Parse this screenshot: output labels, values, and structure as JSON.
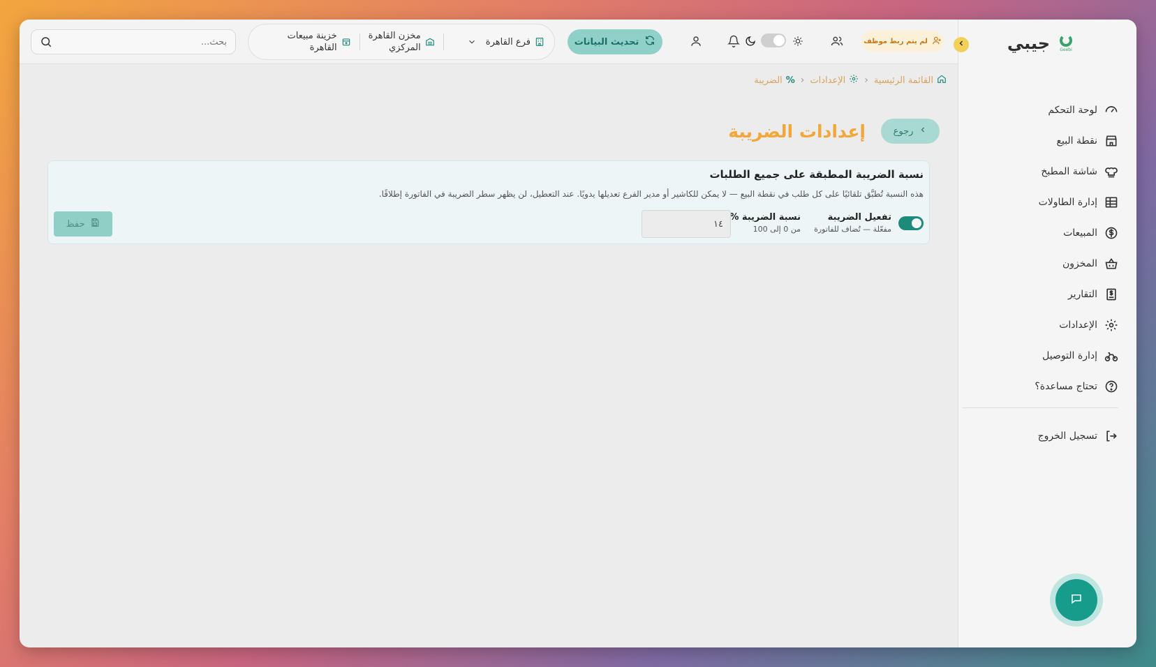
{
  "brand": {
    "name": "جيبي",
    "logo_sub": "Geebi"
  },
  "sidebar": {
    "items": [
      {
        "label": "لوحة التحكم",
        "icon": "gauge-icon"
      },
      {
        "label": "نقطة البيع",
        "icon": "store-icon"
      },
      {
        "label": "شاشة المطبخ",
        "icon": "chef-hat-icon"
      },
      {
        "label": "إدارة الطاولات",
        "icon": "table-grid-icon"
      },
      {
        "label": "المبيعات",
        "icon": "dollar-circle-icon"
      },
      {
        "label": "المخزون",
        "icon": "basket-icon"
      },
      {
        "label": "التقارير",
        "icon": "receipt-icon"
      },
      {
        "label": "الإعدادات",
        "icon": "gear-icon"
      },
      {
        "label": "إدارة التوصيل",
        "icon": "bicycle-icon"
      },
      {
        "label": "تحتاج مساعدة؟",
        "icon": "help-icon"
      }
    ],
    "logout_label": "تسجيل الخروج"
  },
  "topbar": {
    "employee_badge": "لم يتم ربط موظف",
    "refresh_label": "تحديث البيانات",
    "branch": "فرع القاهرة",
    "warehouse_line1": "مخزن القاهرة",
    "warehouse_line2": "المركزي",
    "cashbox_line1": "خزينة مبيعات",
    "cashbox_line2": "القاهرة",
    "search_placeholder": "بحث..."
  },
  "breadcrumb": {
    "home": "القائمة الرئيسية",
    "settings": "الإعدادات",
    "current": "الضريبة"
  },
  "page": {
    "back_label": "رجوع",
    "title": "إعدادات الضريبة"
  },
  "tax_card": {
    "title": "نسبة الضريبة المطبقة على جميع الطلبات",
    "description": "هذه النسبة تُطبَّق تلقائيًا على كل طلب في نقطة البيع — لا يمكن للكاشير أو مدير الفرع تعديلها يدويًا. عند التعطيل، لن يظهر سطر الضريبة في الفاتورة إطلاقًا.",
    "enable_label": "تفعيل الضريبة",
    "enable_status": "مفعّلة — تُضاف للفاتورة",
    "enabled": true,
    "rate_label": "نسبة الضريبة %",
    "rate_hint": "من 0 إلى 100",
    "rate_value": "١٤",
    "save_label": "حفظ"
  },
  "colors": {
    "accent": "#f3a63a",
    "teal": "#1e8a7c",
    "teal_light": "#8fd0c8"
  }
}
